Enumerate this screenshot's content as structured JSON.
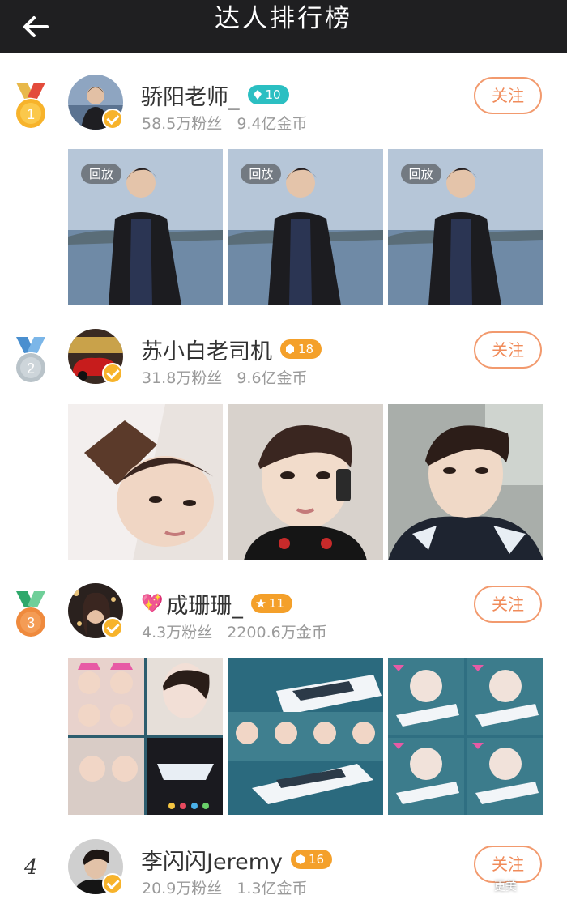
{
  "header": {
    "title": "达人排行榜",
    "back_icon": "arrow-left-icon"
  },
  "entries": [
    {
      "rank": "1",
      "name": "骄阳老师_",
      "level": "10",
      "level_color": "#2bbfc2",
      "fans": "58.5万粉丝",
      "coins": "9.4亿金币",
      "follow_label": "关注",
      "replay_label": "回放"
    },
    {
      "rank": "2",
      "name": "苏小白老司机",
      "level": "18",
      "level_color": "#f4a02a",
      "fans": "31.8万粉丝",
      "coins": "9.6亿金币",
      "follow_label": "关注"
    },
    {
      "rank": "3",
      "name": "成珊珊_",
      "level": "11",
      "level_color": "#f4a02a",
      "fans": "4.3万粉丝",
      "coins": "2200.6万金币",
      "follow_label": "关注"
    },
    {
      "rank": "4",
      "name": "李闪闪Jeremy",
      "level": "16",
      "level_color": "#f4a02a",
      "fans": "20.9万粉丝",
      "coins": "1.3亿金币",
      "follow_label": "关注"
    }
  ],
  "watermark": "更美",
  "colors": {
    "header_bg": "#1f1f21",
    "follow": "#f08b5a",
    "gold": "#f7b32b",
    "silver": "#b9c3c9",
    "bronze": "#ef8a3d"
  }
}
